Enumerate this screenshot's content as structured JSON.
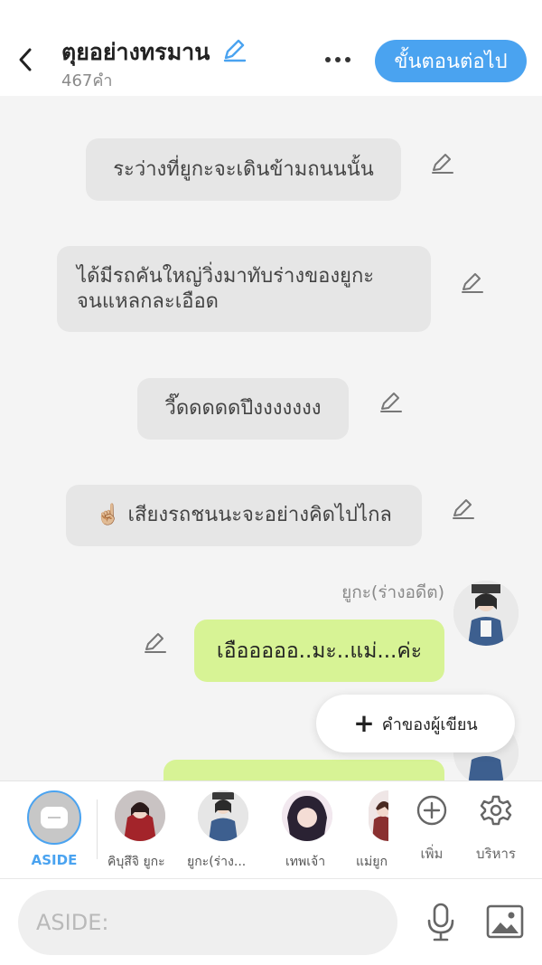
{
  "header": {
    "title": "ตุยอย่างทรมาน",
    "word_count": "467คำ",
    "next_button": "ขั้นตอนต่อไป"
  },
  "messages": {
    "narration1": "ระว่างที่ยูกะจะเดินข้ามถนนนั้น",
    "narration2_line1": "ได้มีรถคันใหญ่วิ่งมาทับร่างของยูกะ",
    "narration2_line2": "จนแหลกละเอือด",
    "narration3": "วี๊ดดดดดปึงงงงงงง",
    "narration4_emoji": "☝🏼",
    "narration4": "เสียงรถชนนะจะอย่างคิดไปไกล",
    "sender_name": "ยูกะ(ร่างอดีต)",
    "dialogue1": "เอือออออ..มะ..แม่...ค่ะ"
  },
  "popup": {
    "label": "คำของผู้เขียน"
  },
  "character_bar": {
    "aside_label": "ASIDE",
    "characters": [
      {
        "label": "คิบุสึจิ ยูกะ"
      },
      {
        "label": "ยูกะ(ร่าง..."
      },
      {
        "label": "เทพเจ้า"
      },
      {
        "label": "แม่ยูก"
      }
    ],
    "add_label": "เพิ่ม",
    "manage_label": "บริหาร"
  },
  "input": {
    "placeholder": "ASIDE:"
  },
  "colors": {
    "accent": "#4aa3f0",
    "dialogue_bubble": "#d7f395",
    "narration_bubble": "#e6e6e6",
    "background": "#f4f4f4"
  },
  "icons": {
    "back": "chevron-left-icon",
    "edit": "pencil-icon",
    "more": "more-horizontal-icon",
    "add": "plus-circle-icon",
    "manage": "gear-icon",
    "mic": "microphone-icon",
    "gallery": "image-icon"
  }
}
